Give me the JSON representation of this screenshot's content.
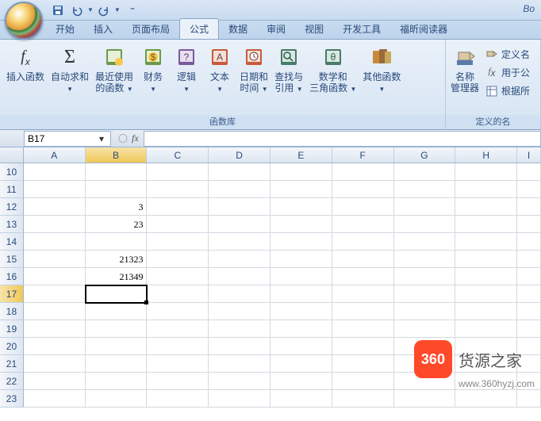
{
  "title_right": "Bo",
  "qat": {
    "save": "保存",
    "undo": "撤销",
    "redo": "重做"
  },
  "tabs": [
    "开始",
    "插入",
    "页面布局",
    "公式",
    "数据",
    "审阅",
    "视图",
    "开发工具",
    "福昕阅读器"
  ],
  "active_tab_index": 3,
  "ribbon": {
    "group_label": "函数库",
    "insert_fn": "插入函数",
    "autosum": "自动求和",
    "recent": "最近使用\n的函数",
    "financial": "财务",
    "logical": "逻辑",
    "text": "文本",
    "datetime": "日期和\n时间",
    "lookup": "查找与\n引用",
    "math": "数学和\n三角函数",
    "other": "其他函数",
    "name_mgr": "名称\n管理器",
    "define_name": "定义名",
    "use_in_formula": "用于公",
    "from_selection": "根据所",
    "group2_label": "定义的名"
  },
  "namebox": "B17",
  "fx_label": "fx",
  "formula": "",
  "columns": [
    "A",
    "B",
    "C",
    "D",
    "E",
    "F",
    "G",
    "H",
    "I"
  ],
  "active_col": "B",
  "rows": [
    10,
    11,
    12,
    13,
    14,
    15,
    16,
    17,
    18,
    19,
    20,
    21,
    22,
    23
  ],
  "active_row": 17,
  "cells": {
    "B12": "3",
    "B13": "23",
    "B15": "21323",
    "B16": "21349"
  },
  "selected_cell": "B17",
  "chart_data": {
    "type": "table",
    "columns": [
      "B"
    ],
    "rows": {
      "12": 3,
      "13": 23,
      "15": 21323,
      "16": 21349
    }
  },
  "watermark": {
    "badge": "360",
    "text": "货源之家",
    "url": "www.360hyzj.com"
  }
}
